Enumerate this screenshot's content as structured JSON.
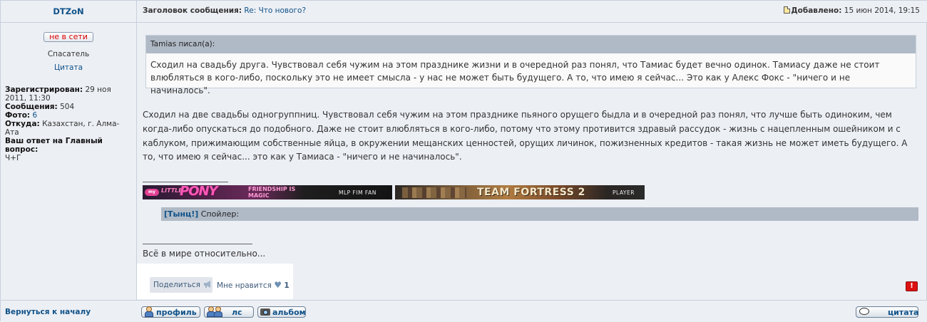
{
  "post": {
    "author": "DTZoN",
    "subject_label": "Заголовок сообщения:",
    "subject": "Re: Что нового?",
    "posted_label": "Добавлено:",
    "posted_date": "15 июн 2014, 19:15"
  },
  "sidebar": {
    "status": "не в сети",
    "rank": "Спасатель",
    "quote_link": "Цитата",
    "registered_label": "Зарегистрирован:",
    "registered_value": "29 ноя 2011, 11:30",
    "posts_label": "Сообщения:",
    "posts_value": "504",
    "photo_label": "Фото:",
    "photo_value": "6",
    "from_label": "Откуда:",
    "from_value": "Казахстан, г. Алма-Ата",
    "question_label": "Ваш ответ на Главный вопрос:",
    "question_value": "Ч+Г"
  },
  "quote": {
    "author_line": "Tamias писал(а):",
    "text": "Сходил на свадьбу друга. Чувствовал себя чужим на этом празднике жизни и в очередной раз понял, что Тамиас будет вечно одинок. Тамиасу даже не стоит влюбляться в кого-либо, поскольку это не имеет смысла - у нас не может быть будущего. А то, что имею я сейчас... Это как у Алекс Фокс - \"ничего и не начиналось\"."
  },
  "reply": {
    "text": "Сходил на две свадьбы одногруппниц. Чувствовал себя чужим на этом празднике пьяного орущего быдла и в очередной раз понял, что лучше быть одиноким, чем когда-либо опускаться до подобного. Даже не стоит влюбляться в кого-либо, потому что этому противится здравый рассудок - жизнь с нацепленным ошейником и с каблуком, прижимающим собственные яйца, в окружении мещанских ценностей, орущих личинок, пожизненных кредитов - такая жизнь не может иметь будущего. А то, что имею я сейчас... это как у Тамиаса - \"ничего и не начиналось\"."
  },
  "signature": {
    "banner_pony": {
      "my": "my",
      "little": "LITTLE",
      "pony": "PONY",
      "fm": "FRIENDSHIP IS MAGIC",
      "fan": "MLP FIM FAN"
    },
    "banner_tf2": {
      "title": "TEAM FORTRESS 2",
      "player": "PLAYER"
    },
    "spoiler_link": "[Тынц!]",
    "spoiler_label": "Спойлер:",
    "motto": "Всё в мире относительно..."
  },
  "social": {
    "share": "Поделиться",
    "like": "Мне нравится",
    "like_count": "1"
  },
  "footer": {
    "back_to_top": "Вернуться к началу",
    "profile": "профиль",
    "pm": "лс",
    "album": "альбом",
    "quote": "цитата"
  },
  "icons": {
    "post": "post-icon",
    "report": "report-icon",
    "share": "megaphone-icon",
    "like": "heart-icon"
  },
  "colors": {
    "link": "#105289",
    "panel_bg": "#eceff4",
    "quote_header": "#b0bac6",
    "offline_status": "#dd0000",
    "report": "#dd1111"
  }
}
